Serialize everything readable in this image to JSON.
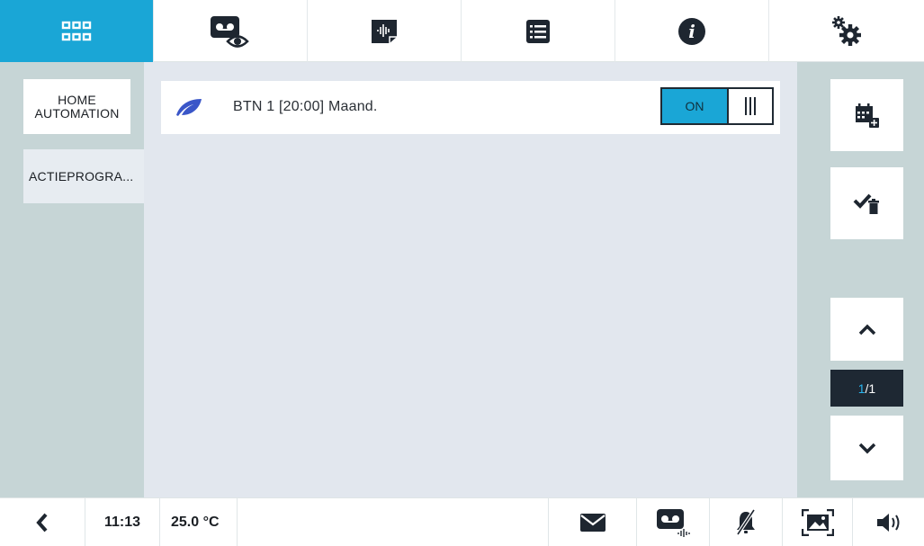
{
  "topbar": {
    "tabs": [
      {
        "icon": "grid-icon",
        "active": true
      },
      {
        "icon": "voicemail-view-icon",
        "active": false
      },
      {
        "icon": "audio-note-icon",
        "active": false
      },
      {
        "icon": "list-icon",
        "active": false
      },
      {
        "icon": "info-icon",
        "active": false
      },
      {
        "icon": "settings-gears-icon",
        "active": false
      }
    ],
    "accent_color": "#1aa6d6"
  },
  "sidebar": {
    "items": [
      {
        "label": "HOME\nAUTOMATION"
      },
      {
        "label": "ACTIEPROGRA..."
      }
    ]
  },
  "main": {
    "rows": [
      {
        "icon": "leaf-icon",
        "label": "BTN 1 [20:00] Maand.",
        "toggle_on_label": "ON",
        "toggle_state": "on"
      }
    ]
  },
  "right_panel": {
    "add_schedule_icon": "calendar-add-icon",
    "delete_checked_icon": "check-delete-icon",
    "page_current": "1",
    "page_total": "/1"
  },
  "statusbar": {
    "time": "11:13",
    "temperature": "25.0 °C",
    "icons": [
      "back-chevron-icon",
      "envelope-icon",
      "voicemail-audio-icon",
      "bell-muted-icon",
      "photo-frame-icon",
      "speaker-icon"
    ]
  }
}
